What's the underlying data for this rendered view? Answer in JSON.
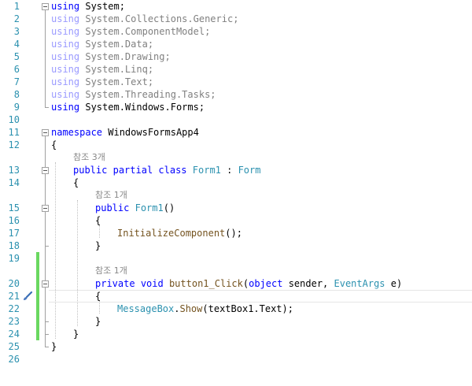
{
  "editor": {
    "lines": [
      {
        "n": "1",
        "indent": 0,
        "tokens": [
          {
            "t": "using",
            "c": "kw"
          },
          {
            "t": " System;",
            "c": ""
          }
        ]
      },
      {
        "n": "2",
        "indent": 0,
        "tokens": [
          {
            "t": "using",
            "c": "kwg"
          },
          {
            "t": " System.Collections.Generic;",
            "c": "txg"
          }
        ]
      },
      {
        "n": "3",
        "indent": 0,
        "tokens": [
          {
            "t": "using",
            "c": "kwg"
          },
          {
            "t": " System.ComponentModel;",
            "c": "txg"
          }
        ]
      },
      {
        "n": "4",
        "indent": 0,
        "tokens": [
          {
            "t": "using",
            "c": "kwg"
          },
          {
            "t": " System.Data;",
            "c": "txg"
          }
        ]
      },
      {
        "n": "5",
        "indent": 0,
        "tokens": [
          {
            "t": "using",
            "c": "kwg"
          },
          {
            "t": " System.Drawing;",
            "c": "txg"
          }
        ]
      },
      {
        "n": "6",
        "indent": 0,
        "tokens": [
          {
            "t": "using",
            "c": "kwg"
          },
          {
            "t": " System.Linq;",
            "c": "txg"
          }
        ]
      },
      {
        "n": "7",
        "indent": 0,
        "tokens": [
          {
            "t": "using",
            "c": "kwg"
          },
          {
            "t": " System.Text;",
            "c": "txg"
          }
        ]
      },
      {
        "n": "8",
        "indent": 0,
        "tokens": [
          {
            "t": "using",
            "c": "kwg"
          },
          {
            "t": " System.Threading.Tasks;",
            "c": "txg"
          }
        ]
      },
      {
        "n": "9",
        "indent": 0,
        "tokens": [
          {
            "t": "using",
            "c": "kw"
          },
          {
            "t": " System.Windows.Forms;",
            "c": ""
          }
        ]
      },
      {
        "n": "10",
        "indent": 0,
        "tokens": []
      },
      {
        "n": "11",
        "indent": 0,
        "tokens": [
          {
            "t": "namespace",
            "c": "kw"
          },
          {
            "t": " WindowsFormsApp4",
            "c": ""
          }
        ]
      },
      {
        "n": "12",
        "indent": 0,
        "tokens": [
          {
            "t": "{",
            "c": ""
          }
        ]
      },
      {
        "lens": "참조 3개",
        "indent": 1
      },
      {
        "n": "13",
        "indent": 1,
        "tokens": [
          {
            "t": "public",
            "c": "kw"
          },
          {
            "t": " ",
            "c": ""
          },
          {
            "t": "partial",
            "c": "kw"
          },
          {
            "t": " ",
            "c": ""
          },
          {
            "t": "class",
            "c": "kw"
          },
          {
            "t": " ",
            "c": ""
          },
          {
            "t": "Form1",
            "c": "ty"
          },
          {
            "t": " : ",
            "c": ""
          },
          {
            "t": "Form",
            "c": "ty"
          }
        ]
      },
      {
        "n": "14",
        "indent": 1,
        "tokens": [
          {
            "t": "{",
            "c": ""
          }
        ]
      },
      {
        "lens": "참조 1개",
        "indent": 2
      },
      {
        "n": "15",
        "indent": 2,
        "tokens": [
          {
            "t": "public",
            "c": "kw"
          },
          {
            "t": " ",
            "c": ""
          },
          {
            "t": "Form1",
            "c": "ty"
          },
          {
            "t": "()",
            "c": ""
          }
        ]
      },
      {
        "n": "16",
        "indent": 2,
        "tokens": [
          {
            "t": "{",
            "c": ""
          }
        ]
      },
      {
        "n": "17",
        "indent": 3,
        "tokens": [
          {
            "t": "InitializeComponent",
            "c": "mt"
          },
          {
            "t": "();",
            "c": ""
          }
        ]
      },
      {
        "n": "18",
        "indent": 2,
        "tokens": [
          {
            "t": "}",
            "c": ""
          }
        ]
      },
      {
        "n": "19",
        "indent": 0,
        "tokens": []
      },
      {
        "lens": "참조 1개",
        "indent": 2
      },
      {
        "n": "20",
        "indent": 2,
        "tokens": [
          {
            "t": "private",
            "c": "kw"
          },
          {
            "t": " ",
            "c": ""
          },
          {
            "t": "void",
            "c": "kw"
          },
          {
            "t": " ",
            "c": ""
          },
          {
            "t": "button1_Click",
            "c": "mt"
          },
          {
            "t": "(",
            "c": ""
          },
          {
            "t": "object",
            "c": "kw"
          },
          {
            "t": " sender, ",
            "c": ""
          },
          {
            "t": "EventArgs",
            "c": "ty"
          },
          {
            "t": " e)",
            "c": ""
          }
        ]
      },
      {
        "n": "21",
        "indent": 2,
        "tokens": [
          {
            "t": "{",
            "c": ""
          }
        ]
      },
      {
        "n": "22",
        "indent": 3,
        "tokens": [
          {
            "t": "MessageBox",
            "c": "ty"
          },
          {
            "t": ".",
            "c": ""
          },
          {
            "t": "Show",
            "c": "mt"
          },
          {
            "t": "(textBox1.Text);",
            "c": ""
          }
        ]
      },
      {
        "n": "23",
        "indent": 2,
        "tokens": [
          {
            "t": "}",
            "c": ""
          }
        ]
      },
      {
        "n": "24",
        "indent": 1,
        "tokens": [
          {
            "t": "}",
            "c": ""
          }
        ]
      },
      {
        "n": "25",
        "indent": 0,
        "tokens": [
          {
            "t": "}",
            "c": ""
          }
        ]
      },
      {
        "n": "26",
        "indent": 0,
        "tokens": []
      }
    ],
    "colors": {
      "keyword": "#0000ff",
      "type": "#2b91af",
      "method": "#74531f",
      "line_number": "#2b91af",
      "change_bar": "#6ad860"
    }
  }
}
